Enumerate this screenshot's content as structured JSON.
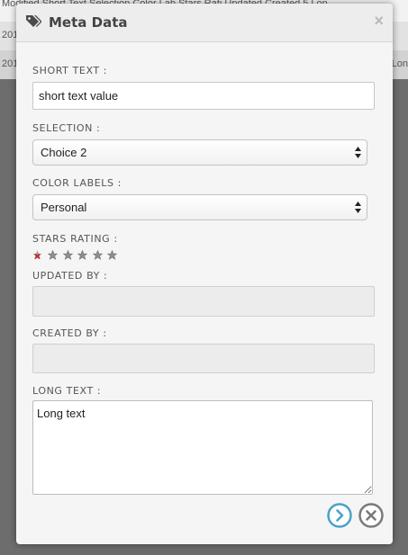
{
  "background_table": {
    "header_text": "Modified   Short Text  Selection   Color Lab  Stars Rati Updated   Created  5 Lon",
    "row1_left": "201",
    "row2_left": "201",
    "row2_right": "Lon"
  },
  "dialog": {
    "title": "Meta Data",
    "close_glyph": "×"
  },
  "fields": {
    "short_text": {
      "label": "SHORT TEXT :",
      "value": "short text value"
    },
    "selection": {
      "label": "SELECTION :",
      "value": "Choice 2"
    },
    "color_labels": {
      "label": "COLOR LABELS :",
      "value": "Personal"
    },
    "stars_rating": {
      "label": "STARS RATING :",
      "value": 0,
      "max": 5
    },
    "updated_by": {
      "label": "UPDATED BY :",
      "value": ""
    },
    "created_by": {
      "label": "CREATED BY :",
      "value": ""
    },
    "long_text": {
      "label": "LONG TEXT :",
      "value": "Long text"
    }
  },
  "buttons": {
    "submit_icon": "chevron-right-circle-icon",
    "cancel_icon": "x-circle-icon"
  },
  "colors": {
    "accent_blue": "#4aa3c8",
    "close_grey": "#7a7a7a"
  }
}
